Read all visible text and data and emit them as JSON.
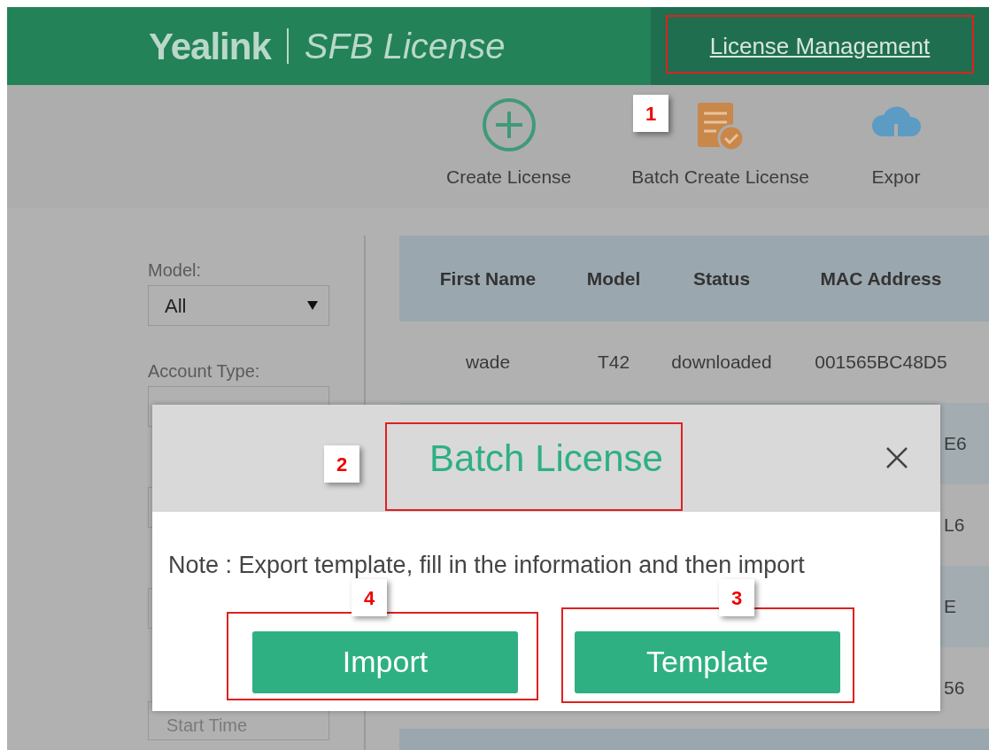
{
  "header": {
    "brand": "Yealink",
    "product": "SFB License",
    "nav": [
      {
        "label": "License Management",
        "selected": true
      }
    ]
  },
  "toolbar": [
    {
      "kind": "create",
      "label": "Create License"
    },
    {
      "kind": "batch",
      "label": "Batch Create License"
    },
    {
      "kind": "export",
      "label": "Expor"
    }
  ],
  "filters": [
    {
      "label": "Model:",
      "value": "All"
    },
    {
      "label": "Account Type:"
    }
  ],
  "start_time": {
    "placeholder": "Start Time"
  },
  "table": {
    "columns": [
      "First Name",
      "Model",
      "Status",
      "MAC Address"
    ],
    "rows": [
      {
        "first_name": "wade",
        "model": "T42",
        "status": "downloaded",
        "mac_address": "001565BC48D5"
      },
      {
        "mac_address": "E6"
      },
      {
        "mac_address": "L6"
      },
      {
        "mac_address": "E"
      },
      {
        "mac_address": "56"
      }
    ]
  },
  "modal": {
    "title": "Batch License",
    "note": "Note : Export template, fill in the information and then import",
    "buttons": [
      "Import",
      "Template"
    ]
  },
  "callouts": [
    "1",
    "2",
    "3",
    "4"
  ]
}
